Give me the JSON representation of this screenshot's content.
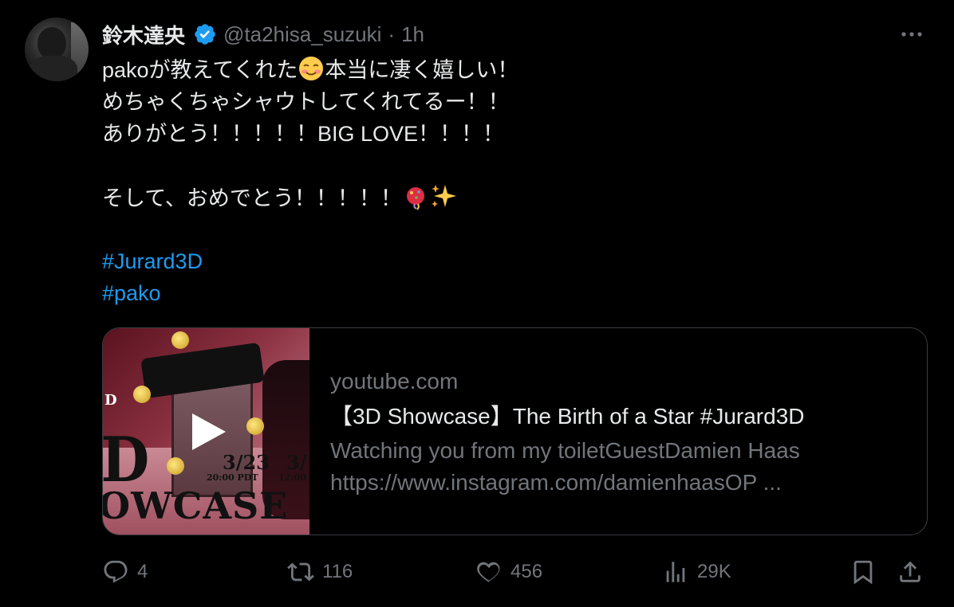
{
  "author": {
    "display_name": "鈴木達央",
    "handle": "@ta2hisa_suzuki",
    "separator": "·",
    "time": "1h",
    "verified": true
  },
  "body": {
    "line1_a": "pakoが教えてくれた",
    "line1_b": "本当に凄く嬉しい！",
    "line2": "めちゃくちゃシャウトしてくれてるー！！",
    "line3": "ありがとう！！！！！BIG LOVE！！！！",
    "line4": "そして、おめでとう！！！！！",
    "hashtags": [
      "#Jurard3D",
      "#pako"
    ]
  },
  "card": {
    "domain": "youtube.com",
    "title": "【3D Showcase】The Birth of a Star #Jurard3D",
    "description_line1": "Watching you from my toiletGuestDamien Haas",
    "description_line2": "https://www.instagram.com/damienhaasOP ...",
    "thumbnail": {
      "small_text": "D",
      "big_text": "D",
      "showcase_text": "OWCASE",
      "date1": "3/23",
      "date2": "3/",
      "time1": "20:00 PDT",
      "time2": "12:00"
    }
  },
  "actions": {
    "replies": "4",
    "reposts": "116",
    "likes": "456",
    "views": "29K"
  },
  "colors": {
    "background": "#000000",
    "text": "#e7e9ea",
    "muted": "#71767b",
    "accent": "#1d9bf0"
  },
  "icons": [
    "verified-badge-icon",
    "more-icon",
    "smiling-face-emoji-icon",
    "party-popper-emoji-icon",
    "sparkles-emoji-icon",
    "play-icon",
    "reply-icon",
    "repost-icon",
    "like-icon",
    "views-icon",
    "bookmark-icon",
    "share-icon"
  ]
}
